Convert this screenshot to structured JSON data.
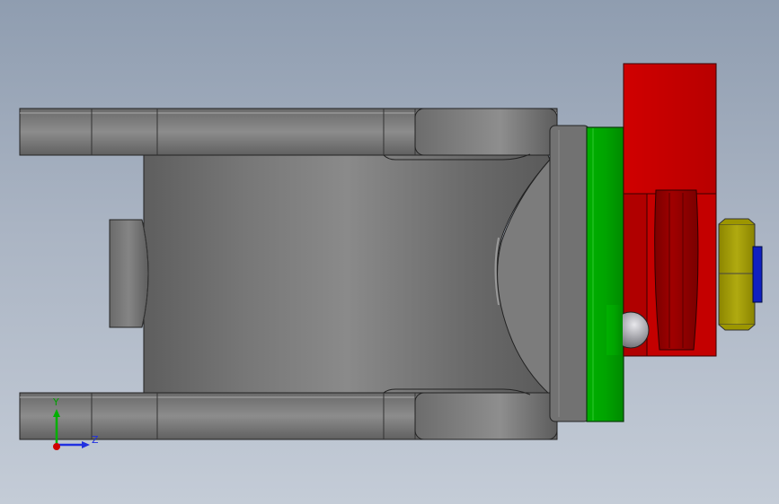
{
  "viewport": {
    "background_top": "#8f9db0",
    "background_bottom": "#c4ccd7"
  },
  "model": {
    "parts": [
      {
        "name": "body",
        "color": "#6b6b6b"
      },
      {
        "name": "flange-ring",
        "color": "#00a000"
      },
      {
        "name": "clamp-block",
        "color": "#cc0000"
      },
      {
        "name": "hex-nut",
        "color": "#a8a000"
      },
      {
        "name": "bolt-end",
        "color": "#1020c0"
      }
    ]
  },
  "triad": {
    "y_label": "Y",
    "z_label": "Z",
    "y_color": "#00b000",
    "z_color": "#2030e0",
    "x_color": "#d00000"
  }
}
